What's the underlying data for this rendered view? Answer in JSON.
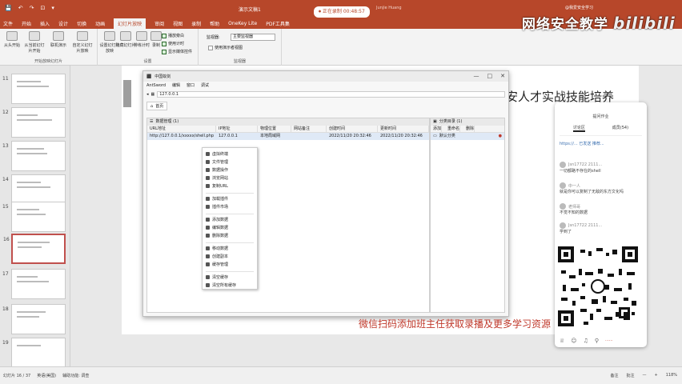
{
  "titlebar": {
    "quick_access": [
      "💾",
      "↶",
      "↷",
      "⊡",
      "▾"
    ],
    "doc_title": "演示文稿1",
    "recording": "⏺ 正在录制 00:48:57",
    "user": "Junjie Huang"
  },
  "ribbon": {
    "tabs": [
      "文件",
      "开始",
      "插入",
      "设计",
      "切换",
      "动画",
      "幻灯片放映",
      "审阅",
      "视图",
      "录制",
      "帮助",
      "OneKey Lite",
      "PDF工具集"
    ],
    "active_tab": "幻灯片放映",
    "groups": {
      "start": {
        "buttons": [
          "从头开始",
          "从当前幻灯片开始",
          "联机演示",
          "自定义幻灯片放映"
        ],
        "label": "开始放映幻灯片"
      },
      "setup": {
        "buttons": [
          "设置幻灯片放映",
          "隐藏幻灯片",
          "排练计时",
          "录制"
        ],
        "checks": [
          "播放旁白",
          "使用计时",
          "显示媒体控件"
        ],
        "label": "设置"
      },
      "monitors": {
        "monitor_label": "监视器:",
        "monitor_value": "主要监视器",
        "presenter_view": "使用演示者视图",
        "label": "监视器"
      }
    }
  },
  "thumbnails": [
    {
      "num": "11",
      "selected": false
    },
    {
      "num": "12",
      "selected": false
    },
    {
      "num": "13",
      "selected": false
    },
    {
      "num": "14",
      "selected": false
    },
    {
      "num": "15",
      "selected": false
    },
    {
      "num": "16",
      "selected": true
    },
    {
      "num": "17",
      "selected": false
    },
    {
      "num": "18",
      "selected": false
    },
    {
      "num": "19",
      "selected": false
    }
  ],
  "slide": {
    "title_partial": "安人才实战技能培养"
  },
  "app_window": {
    "title": "中国蚁剑",
    "app_name": "AntSword",
    "menu": [
      "AntSword",
      "编辑",
      "窗口",
      "调试"
    ],
    "address": "127.0.0.1",
    "tab": "首页",
    "controls": [
      "—",
      "□",
      "✕"
    ],
    "left_panel": {
      "header": "数据管理 (1)",
      "columns": [
        "URL地址",
        "IP地址",
        "物理位置",
        "网站备注",
        "创建时间",
        "更新时间"
      ],
      "rows": [
        {
          "url": "http://127.0.0.1/xxxxx/shell.php",
          "ip": "127.0.0.1",
          "location": "本地局域网",
          "note": "",
          "created": "2022/11/20 20:32:46",
          "updated": "2022/11/20 20:32:46"
        }
      ]
    },
    "right_panel": {
      "header": "分类目录 (1)",
      "actions": [
        "添加",
        "重命名",
        "删除"
      ],
      "item": "默认分类"
    },
    "context_menu": [
      "虚拟终端",
      "文件管理",
      "数据操作",
      "浏览网站",
      "复制URL",
      "加载插件",
      "插件市场",
      "添加数据",
      "编辑数据",
      "删除数据",
      "移动数据",
      "创建副本",
      "缓存管理",
      "清空缓存",
      "清空所有缓存"
    ]
  },
  "chat": {
    "header": "提问作业",
    "tabs": [
      "讨论区",
      "成员(54)"
    ],
    "link_text": "https://... 已发送 推荐...",
    "messages": [
      {
        "who": "Jsn17722 2111...",
        "text": "一切都路不存在的shell"
      },
      {
        "who": "中一人",
        "text": "就是你可以复制了无敌的东方文化吗"
      },
      {
        "who": "老师哥",
        "text": "不觉不知的数据"
      },
      {
        "who": "Jsn17722 2111...",
        "text": "学到了"
      }
    ],
    "footer_icons": [
      "♕",
      "☺",
      "♫",
      "⚲"
    ],
    "footer_red": "......"
  },
  "banner": "微信扫码添加班主任获取录播及更多学习资源",
  "watermark": {
    "title": "网络安全教学",
    "brand": "bilibili",
    "sub": "@我爱安全学习"
  },
  "statusbar": {
    "left": [
      "幻灯片 16 / 37",
      "英语(美国)",
      "辅助功能: 调查"
    ],
    "right": [
      "备注",
      "批注",
      "—",
      "+",
      "118%"
    ]
  },
  "colors": {
    "accent": "#b7472a",
    "banner": "#c0392b"
  }
}
